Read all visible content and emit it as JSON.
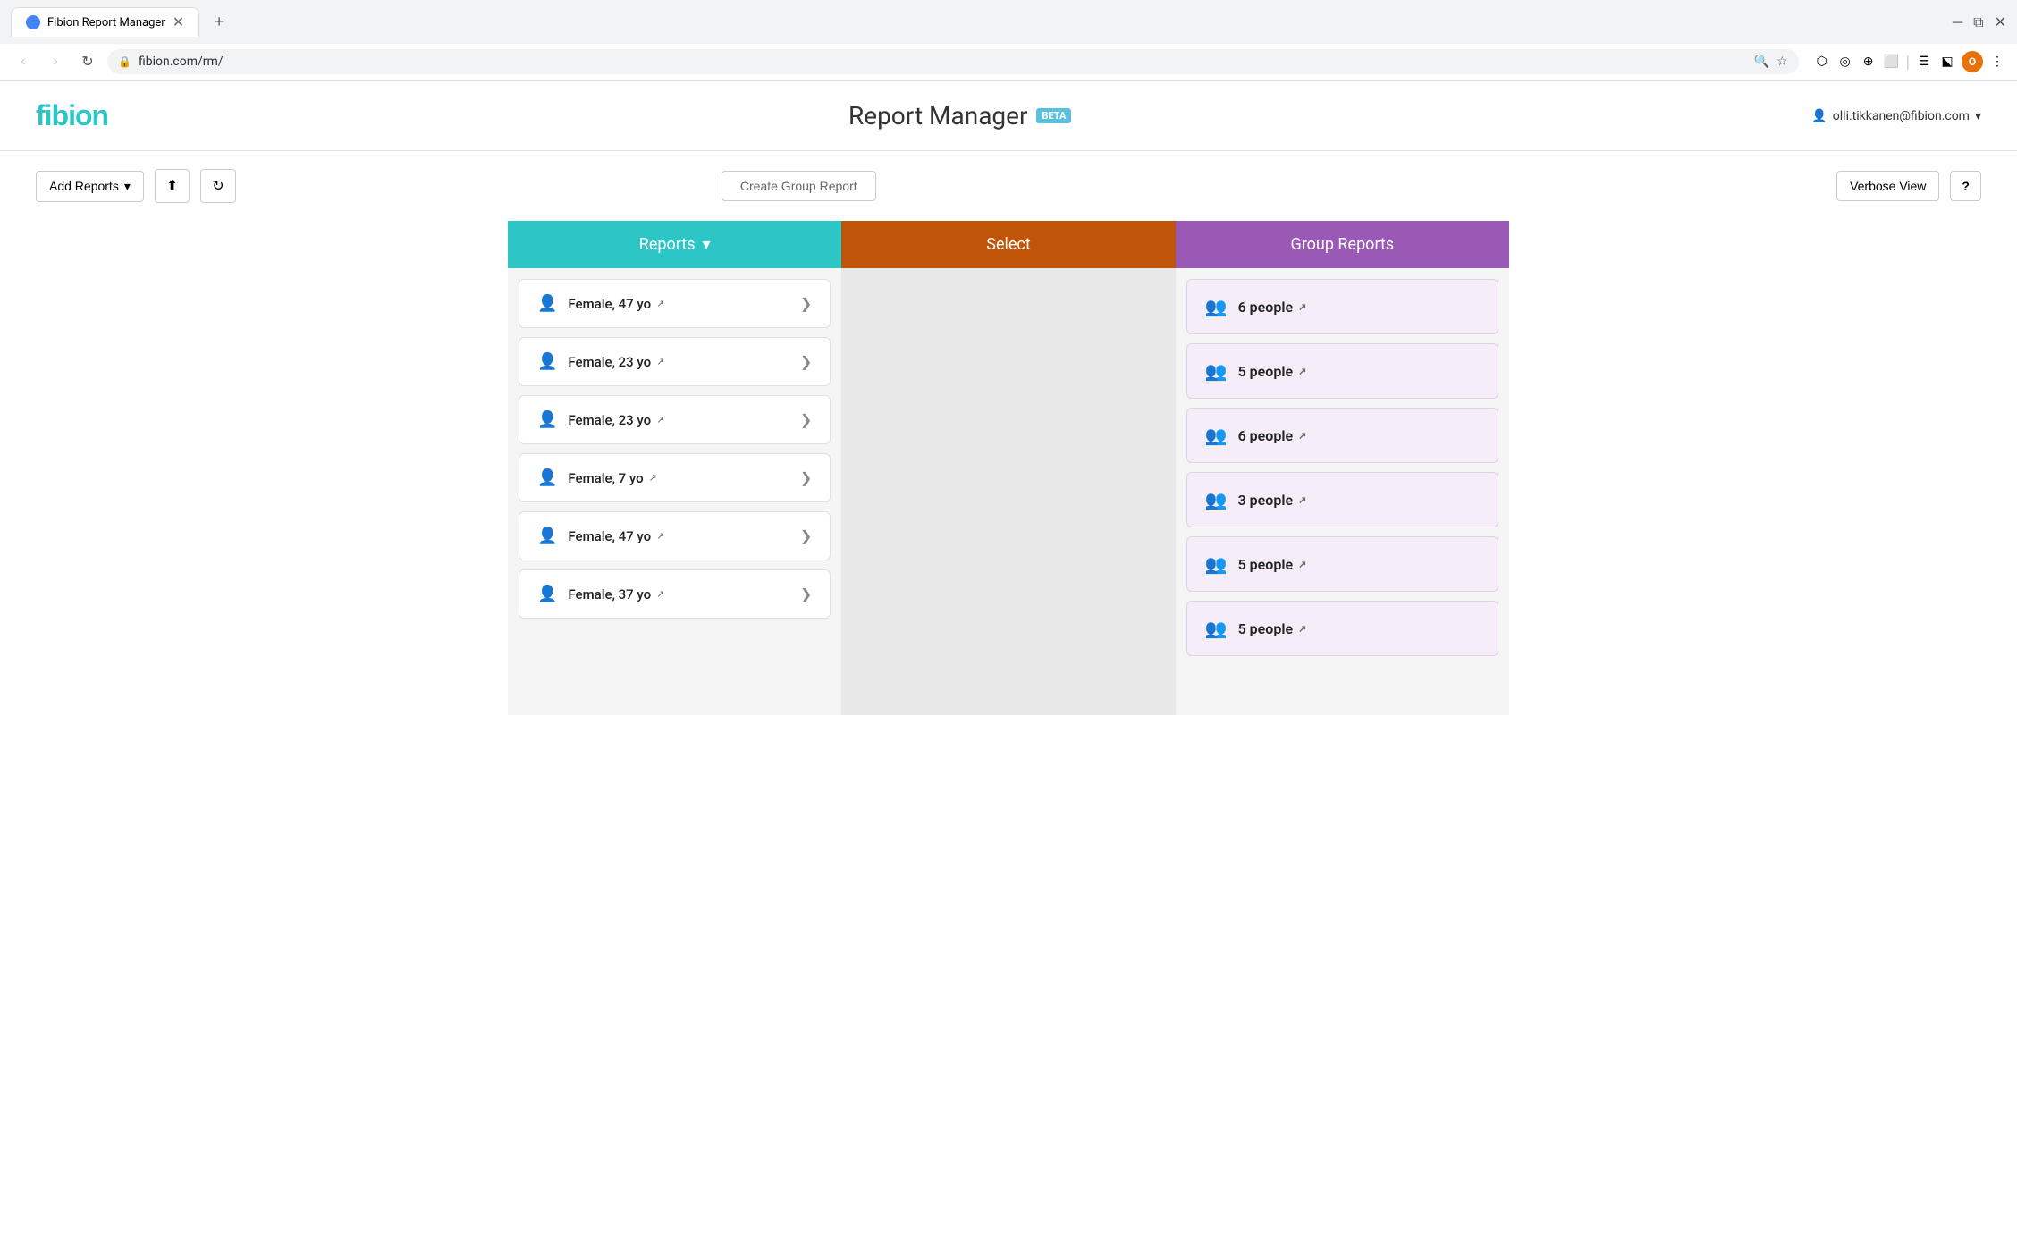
{
  "browser": {
    "tab_title": "Fibion Report Manager",
    "url": "fibion.com/rm/",
    "new_tab_icon": "+",
    "back_disabled": true,
    "forward_disabled": true,
    "profile_letter": "O"
  },
  "header": {
    "logo": "fibion",
    "title": "Report Manager",
    "beta_label": "BETA",
    "user_email": "olli.tikkanen@fibion.com",
    "user_dropdown_icon": "▾"
  },
  "toolbar": {
    "add_reports_label": "Add Reports",
    "add_reports_dropdown": "▾",
    "upload_icon": "⬆",
    "refresh_icon": "↻",
    "create_group_label": "Create Group Report",
    "verbose_view_label": "Verbose View",
    "help_label": "?"
  },
  "columns": {
    "reports": {
      "header": "Reports",
      "header_dropdown": "▾",
      "items": [
        {
          "name": "Female, 47 yo",
          "has_link": true
        },
        {
          "name": "Female, 23 yo",
          "has_link": true
        },
        {
          "name": "Female, 23 yo",
          "has_link": true
        },
        {
          "name": "Female, 7 yo",
          "has_link": true
        },
        {
          "name": "Female, 47 yo",
          "has_link": true
        },
        {
          "name": "Female, 37 yo",
          "has_link": true
        }
      ]
    },
    "select": {
      "header": "Select"
    },
    "group_reports": {
      "header": "Group Reports",
      "items": [
        {
          "count_label": "6 people",
          "has_link": true
        },
        {
          "count_label": "5 people",
          "has_link": true
        },
        {
          "count_label": "6 people",
          "has_link": true
        },
        {
          "count_label": "3 people",
          "has_link": true
        },
        {
          "count_label": "5 people",
          "has_link": true
        },
        {
          "count_label": "5 people",
          "has_link": true
        }
      ]
    }
  },
  "icons": {
    "person": "👤",
    "group": "👥",
    "external_link": "↗",
    "chevron_right": "❯",
    "search": "🔍",
    "star": "☆",
    "refresh": "↻",
    "shield": "🔒"
  }
}
